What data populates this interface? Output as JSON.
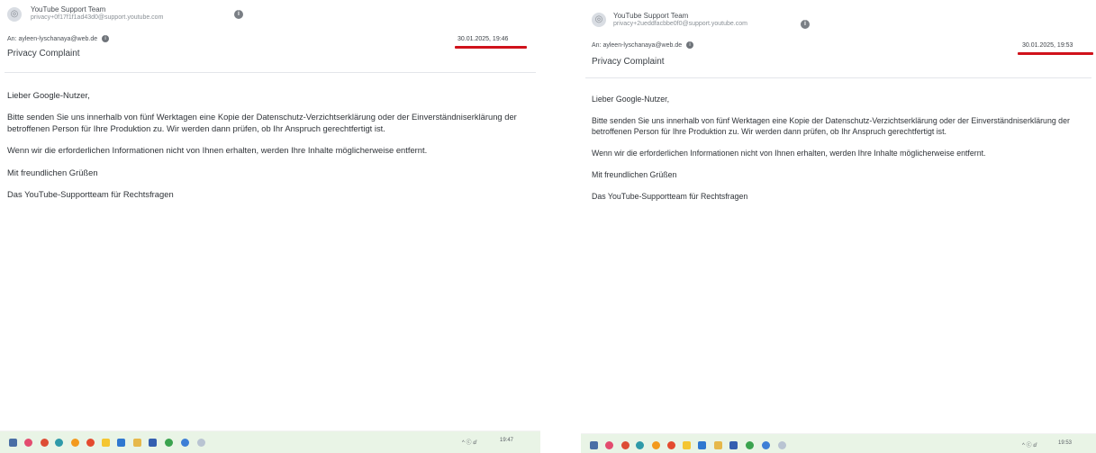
{
  "screens": [
    {
      "sender_name": "YouTube Support Team",
      "sender_email": "privacy+0f17f1f1ad43d0@support.youtube.com",
      "to_prefix": "An:",
      "to_address": "ayleen-lyschanaya@web.de",
      "date": "30.01.2025, 19:46",
      "subject": "Privacy Complaint",
      "greeting": "Lieber Google-Nutzer,",
      "paragraph1": "Bitte senden Sie uns innerhalb von fünf Werktagen eine Kopie der Datenschutz-Verzichtserklärung oder der Einverständniserklärung der betroffenen Person für Ihre Produktion zu. Wir werden dann prüfen, ob Ihr Anspruch gerechtfertigt ist.",
      "paragraph2": "Wenn wir die erforderlichen Informationen nicht von Ihnen erhalten, werden Ihre Inhalte möglicherweise entfernt.",
      "closing": "Mit freundlichen Grüßen",
      "signature": "Das YouTube-Supportteam für Rechtsfragen",
      "tray_text": "^ ⓒ ⅆ",
      "clock": "19:47"
    },
    {
      "sender_name": "YouTube Support Team",
      "sender_email": "privacy+2ueddfacbbe0f0@support.youtube.com",
      "to_prefix": "An:",
      "to_address": "ayleen-lyschanaya@web.de",
      "date": "30.01.2025, 19:53",
      "subject": "Privacy Complaint",
      "greeting": "Lieber Google-Nutzer,",
      "paragraph1": "Bitte senden Sie uns innerhalb von fünf Werktagen eine Kopie der Datenschutz-Verzichtserklärung oder der Einverständniserklärung der betroffenen Person für Ihre Produktion zu. Wir werden dann prüfen, ob Ihr Anspruch gerechtfertigt ist.",
      "paragraph2": "Wenn wir die erforderlichen Informationen nicht von Ihnen erhalten, werden Ihre Inhalte möglicherweise entfernt.",
      "closing": "Mit freundlichen Grüßen",
      "signature": "Das YouTube-Supportteam für Rechtsfragen",
      "tray_text": "^ ⓒ ⅆ",
      "clock": "19:53"
    }
  ],
  "highlight_color": "#d0121b",
  "taskbar_icons": [
    "start-icon",
    "heart-icon",
    "chrome-icon",
    "edge-icon",
    "orange-circle-icon",
    "red-circle-icon",
    "yellow-icon",
    "blue-icon",
    "folder-icon",
    "store-icon",
    "green-icon",
    "blue-round-icon",
    "person-icon"
  ]
}
